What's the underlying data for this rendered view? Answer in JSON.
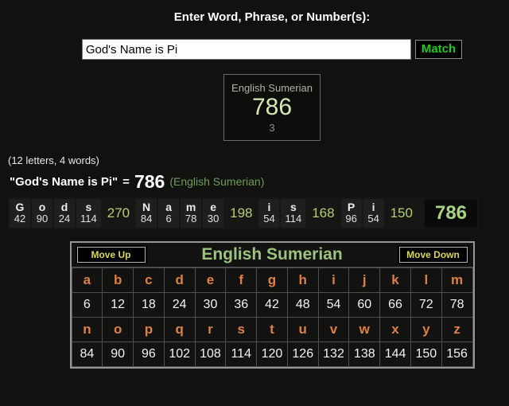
{
  "page": {
    "title": "Enter Word, Phrase, or Number(s):"
  },
  "search": {
    "value": "God's Name is Pi",
    "match_label": "Match"
  },
  "cipher_box": {
    "name": "English Sumerian",
    "value": "786",
    "secondary": "3"
  },
  "stats": "(12 letters, 4 words)",
  "equation": {
    "phrase": "\"God's Name is Pi\"",
    "equals": "=",
    "value": "786",
    "cipher": "(English Sumerian)"
  },
  "breakdown": {
    "words": [
      {
        "word": "Gods",
        "letters": [
          {
            "ch": "G",
            "v": "42"
          },
          {
            "ch": "o",
            "v": "90"
          },
          {
            "ch": "d",
            "v": "24"
          },
          {
            "ch": "s",
            "v": "114"
          }
        ],
        "total": "270"
      },
      {
        "word": "Name",
        "letters": [
          {
            "ch": "N",
            "v": "84"
          },
          {
            "ch": "a",
            "v": "6"
          },
          {
            "ch": "m",
            "v": "78"
          },
          {
            "ch": "e",
            "v": "30"
          }
        ],
        "total": "198"
      },
      {
        "word": "is",
        "letters": [
          {
            "ch": "i",
            "v": "54"
          },
          {
            "ch": "s",
            "v": "114"
          }
        ],
        "total": "168"
      },
      {
        "word": "Pi",
        "letters": [
          {
            "ch": "P",
            "v": "96"
          },
          {
            "ch": "i",
            "v": "54"
          }
        ],
        "total": "150"
      }
    ],
    "grand_total": "786"
  },
  "table": {
    "move_up_label": "Move Up",
    "title": "English Sumerian",
    "move_down_label": "Move Down",
    "rows": [
      [
        "a",
        "b",
        "c",
        "d",
        "e",
        "f",
        "g",
        "h",
        "i",
        "j",
        "k",
        "l",
        "m"
      ],
      [
        "6",
        "12",
        "18",
        "24",
        "30",
        "36",
        "42",
        "48",
        "54",
        "60",
        "66",
        "72",
        "78"
      ],
      [
        "n",
        "o",
        "p",
        "q",
        "r",
        "s",
        "t",
        "u",
        "v",
        "w",
        "x",
        "y",
        "z"
      ],
      [
        "84",
        "90",
        "96",
        "102",
        "108",
        "114",
        "120",
        "126",
        "132",
        "138",
        "144",
        "150",
        "156"
      ]
    ]
  },
  "colors": {
    "match_green": "#1ecb1e",
    "button_yellow": "#d9d950",
    "table_title_green": "#9cc27e",
    "total_green": "#b5d06e",
    "grand_green": "#a8d382",
    "equation_green": "#6d9e53",
    "box_title": "#a9b4a1",
    "box_value": "#d5e7b2",
    "orange": "#de8140"
  }
}
